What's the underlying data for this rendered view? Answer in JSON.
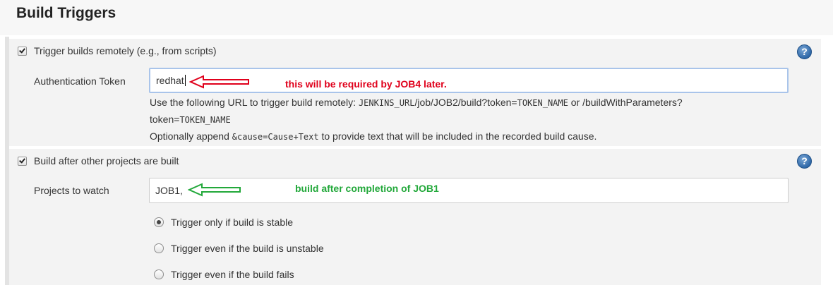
{
  "section": {
    "title": "Build Triggers"
  },
  "remote_trigger": {
    "checkbox_label": "Trigger builds remotely (e.g., from scripts)",
    "checked": true,
    "token_label": "Authentication Token",
    "token_value": "redhat",
    "url_help_prefix": "Use the following URL to trigger build remotely: ",
    "url_code_1": "JENKINS_URL",
    "url_path": "/job/JOB2/build?token=",
    "url_code_2": "TOKEN_NAME",
    "url_or": " or /buildWithParameters?",
    "url_line2_text": "token=",
    "url_code_3": "TOKEN_NAME",
    "append_prefix": "Optionally append ",
    "append_code": "&cause=Cause+Text",
    "append_suffix": " to provide text that will be included in the recorded build cause.",
    "annotation": "this will be required by JOB4 later."
  },
  "build_after": {
    "checkbox_label": "Build after other projects are built",
    "checked": true,
    "projects_label": "Projects to watch",
    "projects_value": "JOB1,",
    "annotation": "build after completion of JOB1",
    "radio_options": [
      {
        "label": "Trigger only if build is stable",
        "selected": true
      },
      {
        "label": "Trigger even if the build is unstable",
        "selected": false
      },
      {
        "label": "Trigger even if the build fails",
        "selected": false
      }
    ]
  },
  "icons": {
    "help": "help-icon",
    "checkbox": "checkbox-checked-icon",
    "arrow": "arrow-left-icon"
  },
  "colors": {
    "annotation_red": "#e0001b",
    "annotation_green": "#22a83a",
    "help_blue": "#2f68a8",
    "panel_bg": "#f3f3f3"
  }
}
